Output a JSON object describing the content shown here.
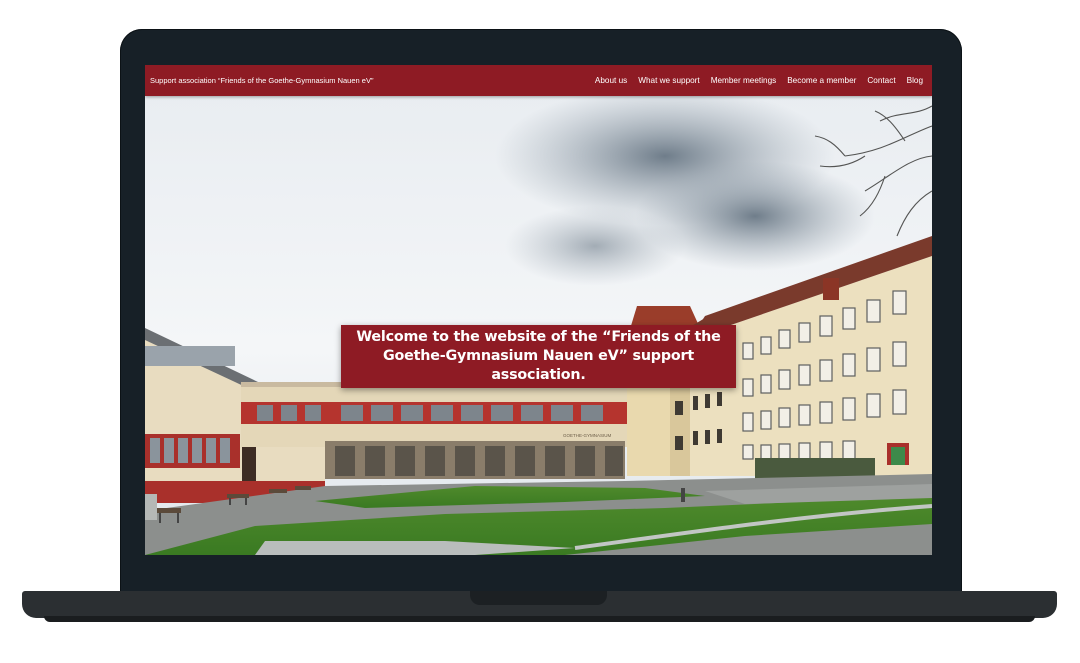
{
  "navbar": {
    "brand": "Support association “Friends of the Goethe-Gymnasium Nauen eV”",
    "links": [
      "About us",
      "What we support",
      "Member meetings",
      "Become a member",
      "Contact",
      "Blog"
    ]
  },
  "hero": {
    "welcome_text": "Welcome to the website of the “Friends of the Goethe-Gymnasium Nauen eV” support association.",
    "building_sign": "GOETHE-GYMNASIUM"
  },
  "colors": {
    "accent": "#8e1b24",
    "laptop_frame": "#172027"
  }
}
